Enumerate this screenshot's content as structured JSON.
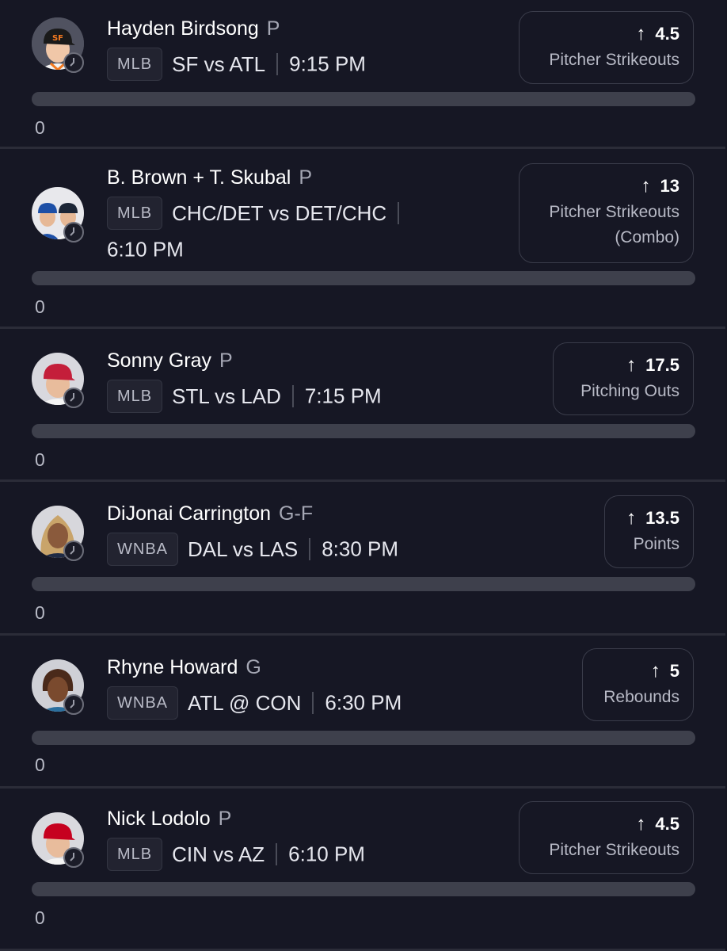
{
  "picks": [
    {
      "player": "Hayden Birdsong",
      "position": "P",
      "league": "MLB",
      "matchup": "SF vs ATL",
      "time": "9:15 PM",
      "line": "4.5",
      "direction_icon": "arrow-up-icon",
      "stat": "Pitcher Strikeouts",
      "progress": "0",
      "avatar_icon": "player-headshot"
    },
    {
      "player": "B. Brown + T. Skubal",
      "position": "P",
      "league": "MLB",
      "matchup": "CHC/DET vs DET/CHC",
      "time": "6:10 PM",
      "line": "13",
      "direction_icon": "arrow-up-icon",
      "stat": "Pitcher Strikeouts",
      "stat_suffix": "(Combo)",
      "progress": "0",
      "avatar_icon": "combo-player-headshots"
    },
    {
      "player": "Sonny Gray",
      "position": "P",
      "league": "MLB",
      "matchup": "STL vs LAD",
      "time": "7:15 PM",
      "line": "17.5",
      "direction_icon": "arrow-up-icon",
      "stat": "Pitching Outs",
      "progress": "0",
      "avatar_icon": "player-headshot"
    },
    {
      "player": "DiJonai Carrington",
      "position": "G-F",
      "league": "WNBA",
      "matchup": "DAL vs LAS",
      "time": "8:30 PM",
      "line": "13.5",
      "direction_icon": "arrow-up-icon",
      "stat": "Points",
      "progress": "0",
      "avatar_icon": "player-headshot"
    },
    {
      "player": "Rhyne Howard",
      "position": "G",
      "league": "WNBA",
      "matchup": "ATL @ CON",
      "time": "6:30 PM",
      "line": "5",
      "direction_icon": "arrow-up-icon",
      "stat": "Rebounds",
      "progress": "0",
      "avatar_icon": "player-headshot"
    },
    {
      "player": "Nick Lodolo",
      "position": "P",
      "league": "MLB",
      "matchup": "CIN vs AZ",
      "time": "6:10 PM",
      "line": "4.5",
      "direction_icon": "arrow-up-icon",
      "stat": "Pitcher Strikeouts",
      "progress": "0",
      "avatar_icon": "player-headshot"
    }
  ],
  "colors": {
    "background": "#141521",
    "card": "#161724",
    "divider": "#2b2c38",
    "progress_track": "#3e404c",
    "muted_text": "#b8bac6",
    "cap_sf": "#1a1a1a",
    "cap_chc": "#1d4fa6",
    "cap_det": "#1c2536",
    "cap_stl": "#c41e3a",
    "cap_cin": "#c6011f"
  }
}
